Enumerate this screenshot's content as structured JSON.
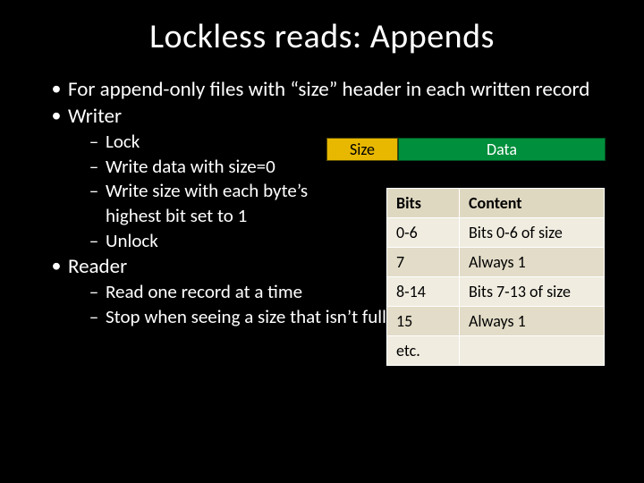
{
  "title": "Lockless reads: Appends",
  "bullets": {
    "b1a": "For append-only files with “size” header in each written record",
    "b1b": "Writer",
    "w1": "Lock",
    "w2": "Write data with size=0",
    "w3": "Write size with each byte’s",
    "w3c": "highest bit set to 1",
    "w4": "Unlock",
    "b1c": "Reader",
    "r1": "Read one record at a time",
    "r2": "Stop when seeing a size that isn’t fully written"
  },
  "diagram": {
    "size_label": "Size",
    "data_label": "Data"
  },
  "table": {
    "head_bits": "Bits",
    "head_content": "Content",
    "rows": [
      {
        "bits": "0-6",
        "content": "Bits 0-6 of size"
      },
      {
        "bits": "7",
        "content": "Always 1"
      },
      {
        "bits": "8-14",
        "content": "Bits 7-13 of size"
      },
      {
        "bits": "15",
        "content": "Always 1"
      },
      {
        "bits": "etc.",
        "content": ""
      }
    ]
  }
}
